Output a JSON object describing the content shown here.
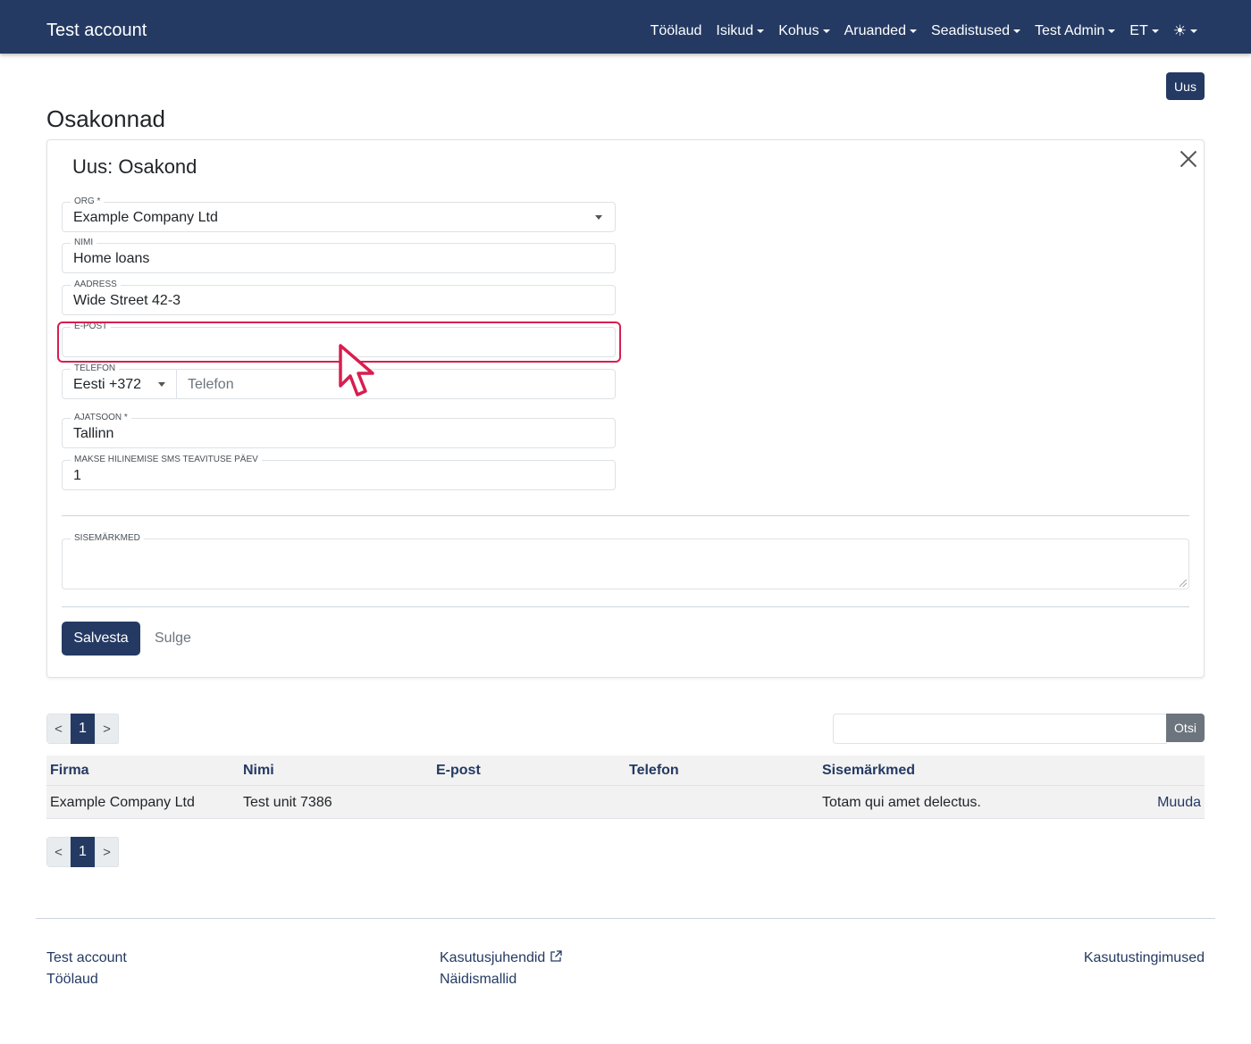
{
  "navbar": {
    "brand": "Test account",
    "items": [
      {
        "label": "Töölaud",
        "dropdown": false
      },
      {
        "label": "Isikud",
        "dropdown": true
      },
      {
        "label": "Kohus",
        "dropdown": true
      },
      {
        "label": "Aruanded",
        "dropdown": true
      },
      {
        "label": "Seadistused",
        "dropdown": true
      },
      {
        "label": "Test Admin",
        "dropdown": true
      },
      {
        "label": "ET",
        "dropdown": true
      }
    ],
    "theme_icon": "☀"
  },
  "new_button": "Uus",
  "page_title": "Osakonnad",
  "form": {
    "title": "Uus: Osakond",
    "org": {
      "label": "ORG *",
      "value": "Example Company Ltd"
    },
    "name": {
      "label": "NIMI",
      "value": "Home loans"
    },
    "address": {
      "label": "AADRESS",
      "value": "Wide Street 42-3"
    },
    "email": {
      "label": "E-POST",
      "value": ""
    },
    "phone": {
      "label": "TELEFON",
      "prefix": "Eesti +372",
      "placeholder": "Telefon"
    },
    "timezone": {
      "label": "AJATSOON *",
      "value": "Tallinn"
    },
    "sms_day": {
      "label": "MAKSE HILINEMISE SMS TEAVITUSE PÄEV",
      "value": "1"
    },
    "notes": {
      "label": "SISEMÄRKMED",
      "value": ""
    },
    "save_label": "Salvesta",
    "close_label": "Sulge"
  },
  "pagination": {
    "prev": "<",
    "current": "1",
    "next": ">"
  },
  "search": {
    "button": "Otsi",
    "value": ""
  },
  "table": {
    "columns": [
      "Firma",
      "Nimi",
      "E-post",
      "Telefon",
      "Sisemärkmed"
    ],
    "rows": [
      {
        "firma": "Example Company Ltd",
        "nimi": "Test unit 7386",
        "epost": "",
        "telefon": "",
        "sisemarkmed": "Totam qui amet delectus.",
        "action": "Muuda"
      }
    ]
  },
  "footer": {
    "col1": [
      "Test account",
      "Töölaud"
    ],
    "col2": [
      "Kasutusjuhendid",
      "Näidismallid"
    ],
    "col3": [
      "Kasutustingimused"
    ]
  },
  "colors": {
    "primary": "#243a63",
    "highlight": "#d81e4f",
    "secondary": "#6c757d"
  }
}
